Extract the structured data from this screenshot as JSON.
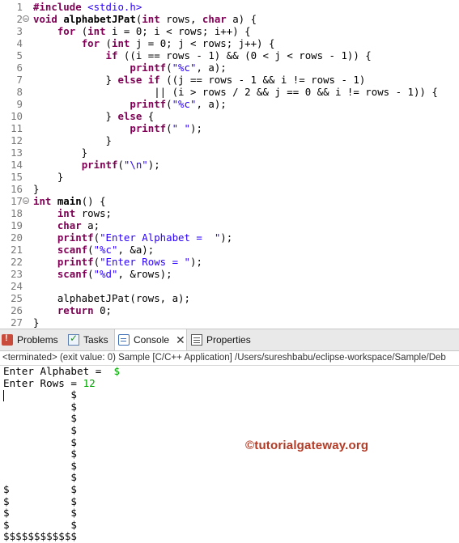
{
  "editor": {
    "lines": [
      {
        "n": "1",
        "fold": false,
        "tokens": [
          {
            "t": "#include ",
            "c": "kw"
          },
          {
            "t": "<stdio.h>",
            "c": "inc"
          }
        ]
      },
      {
        "n": "2",
        "fold": true,
        "tokens": [
          {
            "t": "void ",
            "c": "kw"
          },
          {
            "t": "alphabetJPat",
            "c": "bold"
          },
          {
            "t": "(",
            "c": ""
          },
          {
            "t": "int",
            "c": "kw"
          },
          {
            "t": " rows, ",
            "c": ""
          },
          {
            "t": "char",
            "c": "kw"
          },
          {
            "t": " a) {",
            "c": ""
          }
        ]
      },
      {
        "n": "3",
        "fold": false,
        "tokens": [
          {
            "t": "    ",
            "c": ""
          },
          {
            "t": "for",
            "c": "kw"
          },
          {
            "t": " (",
            "c": ""
          },
          {
            "t": "int",
            "c": "kw"
          },
          {
            "t": " i = 0; i < rows; i++) {",
            "c": ""
          }
        ]
      },
      {
        "n": "4",
        "fold": false,
        "tokens": [
          {
            "t": "        ",
            "c": ""
          },
          {
            "t": "for",
            "c": "kw"
          },
          {
            "t": " (",
            "c": ""
          },
          {
            "t": "int",
            "c": "kw"
          },
          {
            "t": " j = 0; j < rows; j++) {",
            "c": ""
          }
        ]
      },
      {
        "n": "5",
        "fold": false,
        "tokens": [
          {
            "t": "            ",
            "c": ""
          },
          {
            "t": "if",
            "c": "kw"
          },
          {
            "t": " ((i == rows - 1) && (0 < j < rows - 1)) {",
            "c": ""
          }
        ]
      },
      {
        "n": "6",
        "fold": false,
        "tokens": [
          {
            "t": "                ",
            "c": ""
          },
          {
            "t": "printf",
            "c": "kw"
          },
          {
            "t": "(",
            "c": ""
          },
          {
            "t": "\"%c\"",
            "c": "str"
          },
          {
            "t": ", a);",
            "c": ""
          }
        ]
      },
      {
        "n": "7",
        "fold": false,
        "tokens": [
          {
            "t": "            } ",
            "c": ""
          },
          {
            "t": "else if",
            "c": "kw"
          },
          {
            "t": " ((j == rows - 1 && i != rows - 1)",
            "c": ""
          }
        ]
      },
      {
        "n": "8",
        "fold": false,
        "tokens": [
          {
            "t": "                    || (i > rows / 2 && j == 0 && i != rows - 1)) {",
            "c": ""
          }
        ]
      },
      {
        "n": "9",
        "fold": false,
        "tokens": [
          {
            "t": "                ",
            "c": ""
          },
          {
            "t": "printf",
            "c": "kw"
          },
          {
            "t": "(",
            "c": ""
          },
          {
            "t": "\"%c\"",
            "c": "str"
          },
          {
            "t": ", a);",
            "c": ""
          }
        ]
      },
      {
        "n": "10",
        "fold": false,
        "tokens": [
          {
            "t": "            } ",
            "c": ""
          },
          {
            "t": "else",
            "c": "kw"
          },
          {
            "t": " {",
            "c": ""
          }
        ]
      },
      {
        "n": "11",
        "fold": false,
        "tokens": [
          {
            "t": "                ",
            "c": ""
          },
          {
            "t": "printf",
            "c": "kw"
          },
          {
            "t": "(",
            "c": ""
          },
          {
            "t": "\" \"",
            "c": "str"
          },
          {
            "t": ");",
            "c": ""
          }
        ]
      },
      {
        "n": "12",
        "fold": false,
        "tokens": [
          {
            "t": "            }",
            "c": ""
          }
        ]
      },
      {
        "n": "13",
        "fold": false,
        "tokens": [
          {
            "t": "        }",
            "c": ""
          }
        ]
      },
      {
        "n": "14",
        "fold": false,
        "tokens": [
          {
            "t": "        ",
            "c": ""
          },
          {
            "t": "printf",
            "c": "kw"
          },
          {
            "t": "(",
            "c": ""
          },
          {
            "t": "\"\\n\"",
            "c": "str"
          },
          {
            "t": ");",
            "c": ""
          }
        ]
      },
      {
        "n": "15",
        "fold": false,
        "tokens": [
          {
            "t": "    }",
            "c": ""
          }
        ]
      },
      {
        "n": "16",
        "fold": false,
        "tokens": [
          {
            "t": "}",
            "c": ""
          }
        ]
      },
      {
        "n": "17",
        "fold": true,
        "tokens": [
          {
            "t": "int ",
            "c": "kw"
          },
          {
            "t": "main",
            "c": "bold"
          },
          {
            "t": "() {",
            "c": ""
          }
        ]
      },
      {
        "n": "18",
        "fold": false,
        "tokens": [
          {
            "t": "    ",
            "c": ""
          },
          {
            "t": "int",
            "c": "kw"
          },
          {
            "t": " rows;",
            "c": ""
          }
        ]
      },
      {
        "n": "19",
        "fold": false,
        "tokens": [
          {
            "t": "    ",
            "c": ""
          },
          {
            "t": "char",
            "c": "kw"
          },
          {
            "t": " a;",
            "c": ""
          }
        ]
      },
      {
        "n": "20",
        "fold": false,
        "tokens": [
          {
            "t": "    ",
            "c": ""
          },
          {
            "t": "printf",
            "c": "kw"
          },
          {
            "t": "(",
            "c": ""
          },
          {
            "t": "\"Enter Alphabet =  \"",
            "c": "str"
          },
          {
            "t": ");",
            "c": ""
          }
        ]
      },
      {
        "n": "21",
        "fold": false,
        "tokens": [
          {
            "t": "    ",
            "c": ""
          },
          {
            "t": "scanf",
            "c": "kw"
          },
          {
            "t": "(",
            "c": ""
          },
          {
            "t": "\"%c\"",
            "c": "str"
          },
          {
            "t": ", &a);",
            "c": ""
          }
        ]
      },
      {
        "n": "22",
        "fold": false,
        "tokens": [
          {
            "t": "    ",
            "c": ""
          },
          {
            "t": "printf",
            "c": "kw"
          },
          {
            "t": "(",
            "c": ""
          },
          {
            "t": "\"Enter Rows = \"",
            "c": "str"
          },
          {
            "t": ");",
            "c": ""
          }
        ]
      },
      {
        "n": "23",
        "fold": false,
        "tokens": [
          {
            "t": "    ",
            "c": ""
          },
          {
            "t": "scanf",
            "c": "kw"
          },
          {
            "t": "(",
            "c": ""
          },
          {
            "t": "\"%d\"",
            "c": "str"
          },
          {
            "t": ", &rows);",
            "c": ""
          }
        ]
      },
      {
        "n": "24",
        "fold": false,
        "tokens": []
      },
      {
        "n": "25",
        "fold": false,
        "tokens": [
          {
            "t": "    alphabetJPat(rows, a);",
            "c": ""
          }
        ]
      },
      {
        "n": "26",
        "fold": false,
        "tokens": [
          {
            "t": "    ",
            "c": ""
          },
          {
            "t": "return",
            "c": "kw"
          },
          {
            "t": " 0;",
            "c": ""
          }
        ]
      },
      {
        "n": "27",
        "fold": false,
        "tokens": [
          {
            "t": "}",
            "c": ""
          }
        ]
      }
    ]
  },
  "tabs": {
    "problems": "Problems",
    "tasks": "Tasks",
    "console": "Console",
    "properties": "Properties"
  },
  "console": {
    "status": "<terminated> (exit value: 0) Sample [C/C++ Application] /Users/sureshbabu/eclipse-workspace/Sample/Deb",
    "prompt1": "Enter Alphabet =  ",
    "input1": "$",
    "prompt2": "Enter Rows = ",
    "input2": "12",
    "output": [
      "           $",
      "           $",
      "           $",
      "           $",
      "           $",
      "           $",
      "           $",
      "           $",
      "$          $",
      "$          $",
      "$          $",
      "$          $",
      "$$$$$$$$$$$$"
    ]
  },
  "watermark": "©tutorialgateway.org"
}
